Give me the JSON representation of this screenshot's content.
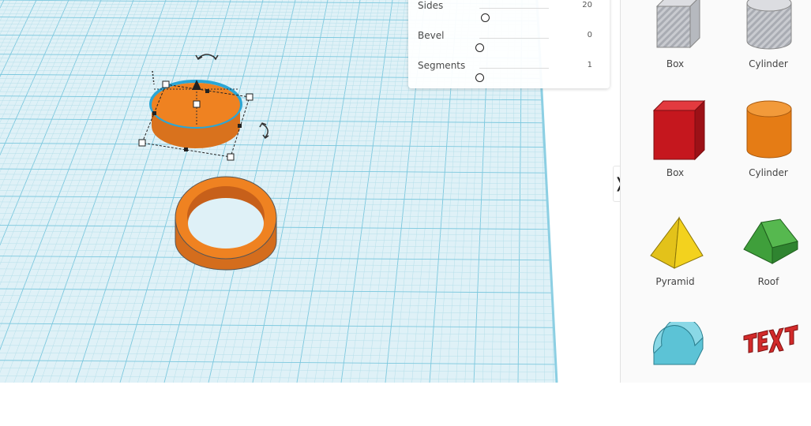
{
  "inspector": {
    "properties": [
      {
        "label": "Sides",
        "value": "20",
        "level": 0.08
      },
      {
        "label": "Bevel",
        "value": "0",
        "level": 0.0
      },
      {
        "label": "Segments",
        "value": "1",
        "level": 0.0
      }
    ]
  },
  "shapes_panel": {
    "toggle_glyph": "❭",
    "tiles": [
      {
        "label": "Box",
        "icon": "box-hole-icon"
      },
      {
        "label": "Cylinder",
        "icon": "cylinder-hole-icon"
      },
      {
        "label": "Box",
        "icon": "box-icon"
      },
      {
        "label": "Cylinder",
        "icon": "cylinder-icon"
      },
      {
        "label": "Pyramid",
        "icon": "pyramid-icon"
      },
      {
        "label": "Roof",
        "icon": "roof-icon"
      },
      {
        "label": "",
        "icon": "round-roof-icon"
      },
      {
        "label": "",
        "icon": "text-icon"
      }
    ]
  },
  "colors": {
    "grid_minor": "#b5dfea",
    "grid_major": "#7cc8de",
    "orange": "#ef8221",
    "orange_dark": "#c9651a",
    "selection": "#2aa6d6"
  }
}
